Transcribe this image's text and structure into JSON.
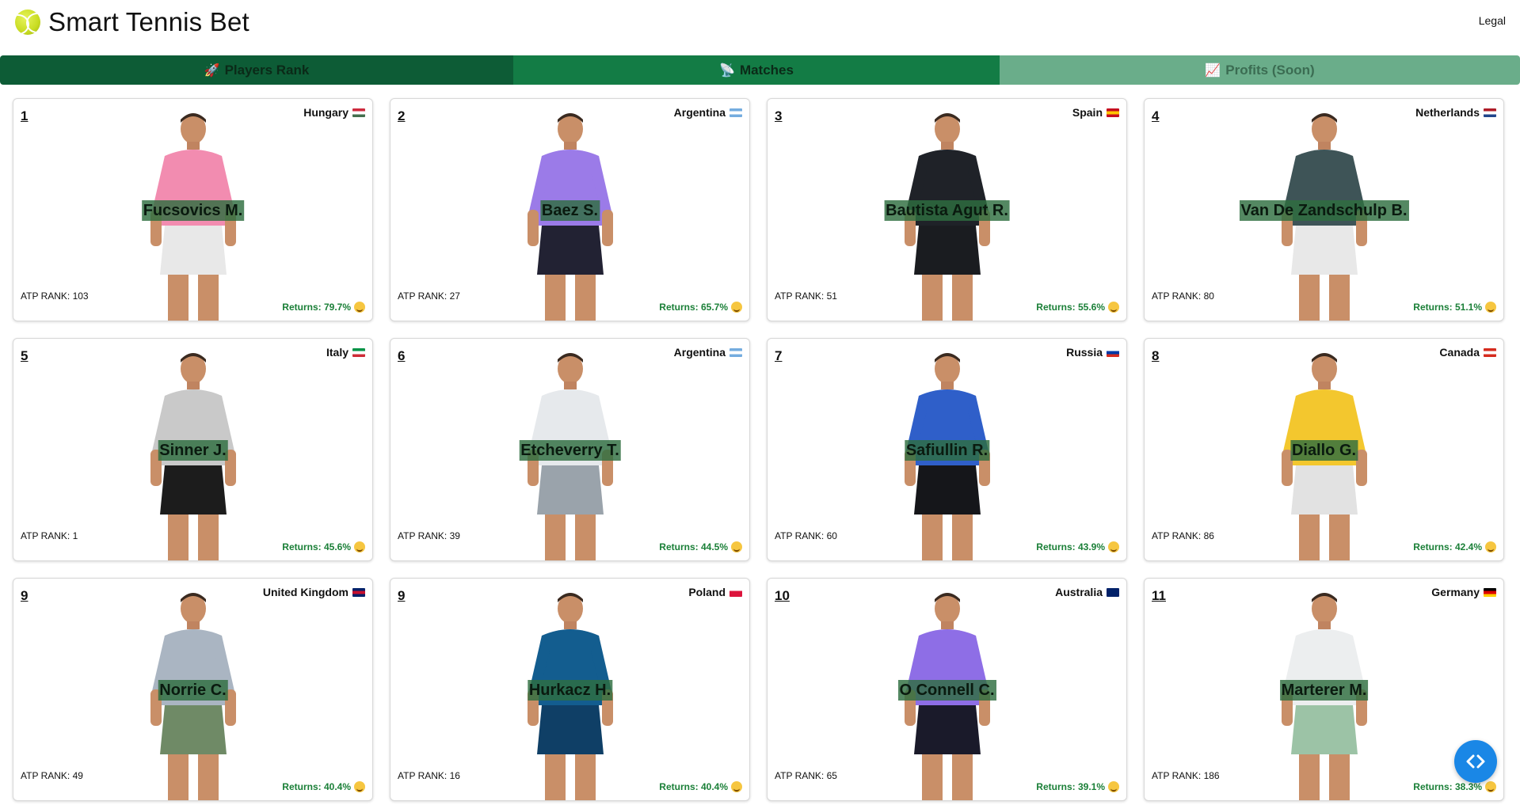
{
  "header": {
    "title": "Smart Tennis Bet",
    "legal_label": "Legal",
    "logo_icon": "tennis-ball-icon"
  },
  "tabs": [
    {
      "label": "Players Rank",
      "icon": "rocket-icon",
      "glyph": "🚀"
    },
    {
      "label": "Matches",
      "icon": "satellite-dish-icon",
      "glyph": "📡"
    },
    {
      "label": "Profits (Soon)",
      "icon": "chart-increasing-icon",
      "glyph": "📈"
    }
  ],
  "players": [
    {
      "rank": "1",
      "name": "Fucsovics M.",
      "country": "Hungary",
      "atp": "ATP RANK: 103",
      "returns": "Returns: 79.7%",
      "shirt": "#f28cb0",
      "shorts": "#e8e8e8"
    },
    {
      "rank": "2",
      "name": "Baez S.",
      "country": "Argentina",
      "atp": "ATP RANK: 27",
      "returns": "Returns: 65.7%",
      "shirt": "#9b7be8",
      "shorts": "#222233"
    },
    {
      "rank": "3",
      "name": "Bautista Agut R.",
      "country": "Spain",
      "atp": "ATP RANK: 51",
      "returns": "Returns: 55.6%",
      "shirt": "#1f2228",
      "shorts": "#1a1c20"
    },
    {
      "rank": "4",
      "name": "Van De Zandschulp B.",
      "country": "Netherlands",
      "atp": "ATP RANK: 80",
      "returns": "Returns: 51.1%",
      "shirt": "#3e5457",
      "shorts": "#e8e8e8"
    },
    {
      "rank": "5",
      "name": "Sinner J.",
      "country": "Italy",
      "atp": "ATP RANK: 1",
      "returns": "Returns: 45.6%",
      "shirt": "#c9c9c9",
      "shorts": "#1c1c1c"
    },
    {
      "rank": "6",
      "name": "Etcheverry T.",
      "country": "Argentina",
      "atp": "ATP RANK: 39",
      "returns": "Returns: 44.5%",
      "shirt": "#e6e9ec",
      "shorts": "#9aa3ab"
    },
    {
      "rank": "7",
      "name": "Safiullin R.",
      "country": "Russia",
      "atp": "ATP RANK: 60",
      "returns": "Returns: 43.9%",
      "shirt": "#2f5fc9",
      "shorts": "#15161a"
    },
    {
      "rank": "8",
      "name": "Diallo G.",
      "country": "Canada",
      "atp": "ATP RANK: 86",
      "returns": "Returns: 42.4%",
      "shirt": "#f3c72e",
      "shorts": "#e2e2e2"
    },
    {
      "rank": "9",
      "name": "Norrie C.",
      "country": "United Kingdom",
      "atp": "ATP RANK: 49",
      "returns": "Returns: 40.4%",
      "shirt": "#aab5c2",
      "shorts": "#6f8a66"
    },
    {
      "rank": "9",
      "name": "Hurkacz H.",
      "country": "Poland",
      "atp": "ATP RANK: 16",
      "returns": "Returns: 40.4%",
      "shirt": "#135d8f",
      "shorts": "#0f3f66"
    },
    {
      "rank": "10",
      "name": "O Connell C.",
      "country": "Australia",
      "atp": "ATP RANK: 65",
      "returns": "Returns: 39.1%",
      "shirt": "#8e6ee6",
      "shorts": "#1a1a2a"
    },
    {
      "rank": "11",
      "name": "Marterer M.",
      "country": "Germany",
      "atp": "ATP RANK: 186",
      "returns": "Returns: 38.3%",
      "shirt": "#eceeef",
      "shorts": "#9cc3a6"
    }
  ],
  "flags": {
    "Hungary": [
      "#cd2a3e",
      "#ffffff",
      "#436f4d"
    ],
    "Argentina": [
      "#74acdf",
      "#ffffff",
      "#74acdf"
    ],
    "Spain": [
      "#c60b1e",
      "#ffc400",
      "#c60b1e"
    ],
    "Netherlands": [
      "#ae1c28",
      "#ffffff",
      "#21468b"
    ],
    "Italy": [
      "#009246",
      "#ffffff",
      "#ce2b37"
    ],
    "Russia": [
      "#ffffff",
      "#0039a6",
      "#d52b1e"
    ],
    "Canada": [
      "#d52b1e",
      "#ffffff",
      "#d52b1e"
    ],
    "United Kingdom": [
      "#012169",
      "#c8102e",
      "#012169"
    ],
    "Poland": [
      "#ffffff",
      "#dc143c",
      "#dc143c"
    ],
    "Australia": [
      "#012169",
      "#012169",
      "#012169"
    ],
    "Germany": [
      "#000000",
      "#dd0000",
      "#ffce00"
    ]
  },
  "fab": {
    "icon": "code-brackets-icon"
  }
}
